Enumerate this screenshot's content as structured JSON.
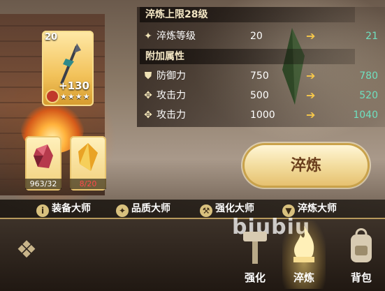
{
  "equipment": {
    "level": "20",
    "enhance": "+130",
    "stars": "★★★★",
    "weapon_icon": "spear-icon"
  },
  "stats": {
    "header_limit": "淬炼上限28级",
    "smelt_level": {
      "name": "淬炼等级",
      "current": "20",
      "next": "21",
      "icon": "sparkle-icon"
    },
    "extra_header": "附加属性",
    "rows": [
      {
        "name": "防御力",
        "current": "750",
        "next": "780",
        "icon": "shield-icon"
      },
      {
        "name": "攻击力",
        "current": "500",
        "next": "520",
        "icon": "sword-icon"
      },
      {
        "name": "攻击力",
        "current": "1000",
        "next": "1040",
        "icon": "sword-icon"
      }
    ]
  },
  "materials": [
    {
      "count": "963/32",
      "color": "#ffffff",
      "icon": "red-ore-icon"
    },
    {
      "count": "8/20",
      "color": "#ff4a4a",
      "icon": "amber-crystal-icon"
    }
  ],
  "action": {
    "smelt_label": "淬炼"
  },
  "masters": [
    {
      "label": "装备大师",
      "icon": "info-icon"
    },
    {
      "label": "品质大师",
      "icon": "star-icon"
    },
    {
      "label": "强化大师",
      "icon": "hammer-icon"
    },
    {
      "label": "淬炼大师",
      "icon": "anvil-icon"
    }
  ],
  "tabs": [
    {
      "label": "强化",
      "icon": "hammer-icon",
      "active": false
    },
    {
      "label": "淬炼",
      "icon": "flame-icon",
      "active": true
    },
    {
      "label": "背包",
      "icon": "backpack-icon",
      "active": false
    }
  ],
  "watermark": "biubiu",
  "colors": {
    "gold": "#f7c84a",
    "next_value": "#6fe0c0",
    "insufficient": "#ff4a4a"
  }
}
